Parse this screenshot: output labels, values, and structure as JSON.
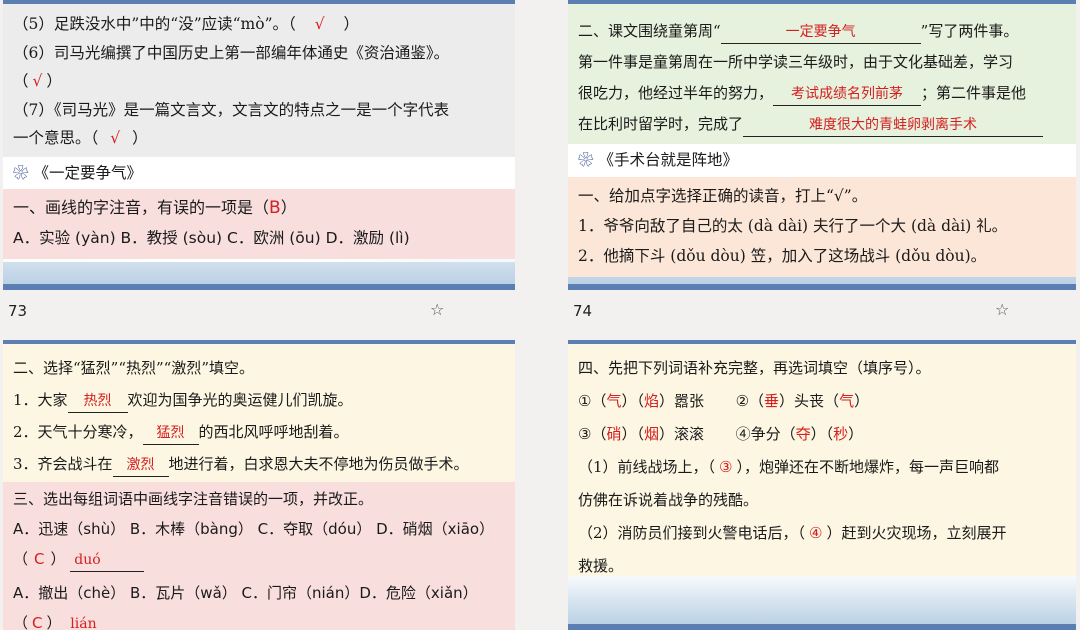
{
  "p73": {
    "page_number": "73",
    "l5_text": "（5）足跌没水中”中的“没”应读“mò”。（",
    "l5_ans": "√",
    "l5_end": "）",
    "l6_text": "（6）司马光编撰了中国历史上第一部编年体通史《资治通鉴》。",
    "l6_open": "（",
    "l6_ans": "√",
    "l6_end": "）",
    "l7_text": "（7）《司马光》是一篇文言文，文言文的特点之一是一个字代表",
    "l7_cont": "一个意思。（",
    "l7_ans": "√",
    "l7_end": "）",
    "title": "《一定要争气》",
    "q1": "一、画线的字注音，有误的一项是（",
    "q1_ans": "B",
    "q1_end": "）",
    "options": "A．实验 (yàn)  B．教授 (sòu)  C．欧洲 (ōu)  D．激励 (lì)"
  },
  "p74": {
    "page_number": "74",
    "q2_a": "二、课文围绕童第周“",
    "q2_ans1": "一定要争气",
    "q2_b": "”写了两件事。",
    "q2_c": "第一件事是童第周在一所中学读三年级时，由于文化基础差，学习",
    "q2_d": "很吃力，他经过半年的努力，",
    "q2_ans2": "考试成绩名列前茅",
    "q2_e": "；第二件事是他",
    "q2_f": "在比利时留学时，完成了",
    "q2_ans3": "难度很大的青蛙卵剥离手术",
    "title": "《手术台就是阵地》",
    "q1": "一、给加点字选择正确的读音，打上“√”。",
    "r1": "1．爷爷向敌了自己的太 (dà  dài) 夫行了一个大 (dà  dài) 礼。",
    "r2": "2．他摘下斗 (dǒu  dòu) 笠，加入了这场战斗 (dǒu  dòu)。"
  },
  "p75": {
    "q2": "二、选择“猛烈”“热烈”“激烈”填空。",
    "s1a": "1．大家",
    "s1ans": "热烈",
    "s1b": "欢迎为国争光的奥运健儿们凯旋。",
    "s2a": "2．天气十分寒冷，",
    "s2ans": "猛烈",
    "s2b": "的西北风呼呼地刮着。",
    "s3a": "3．齐会战斗在",
    "s3ans": "激烈",
    "s3b": "地进行着，白求恩大夫不停地为伤员做手术。",
    "q3": "三、选出每组词语中画线字注音错误的一项，并改正。",
    "g1": "A．迅速（shù） B．木棒（bàng） C．夺取（dóu） D．硝烟（xiāo）",
    "g1_open": "（",
    "g1_choice": "C",
    "g1_close": "）",
    "g1_fix": "duó",
    "g2": "A．撤出（chè）  B．瓦片（wǎ）   C．门帘（nián）D．危险（xiǎn）",
    "g2_open": "（",
    "g2_choice": "C",
    "g2_close": "）",
    "g2_fix": "lián"
  },
  "p76": {
    "q4": "四、先把下列词语补充完整，再选词填空（填序号）。",
    "w1": [
      "①（",
      "气",
      "）（",
      "焰",
      "）嚣张"
    ],
    "w2": [
      "②（",
      "垂",
      "）头丧（",
      "气",
      "）"
    ],
    "w3": [
      "③（",
      "硝",
      "）（",
      "烟",
      "）滚滚"
    ],
    "w4": [
      "④争分（",
      "夺",
      "）（",
      "秒",
      "）"
    ],
    "f1a": "（1）前线战场上，（",
    "f1ans": "③",
    "f1b": "），炮弹还在不断地爆炸，每一声巨响都",
    "f1c": "仿佛在诉说着战争的残酷。",
    "f2a": "（2）消防员们接到火警电话后，（",
    "f2ans": "④",
    "f2b": "）赶到火灾现场，立刻展开",
    "f2c": "救援。"
  },
  "icons": {
    "flower": "❀",
    "star": "☆"
  }
}
